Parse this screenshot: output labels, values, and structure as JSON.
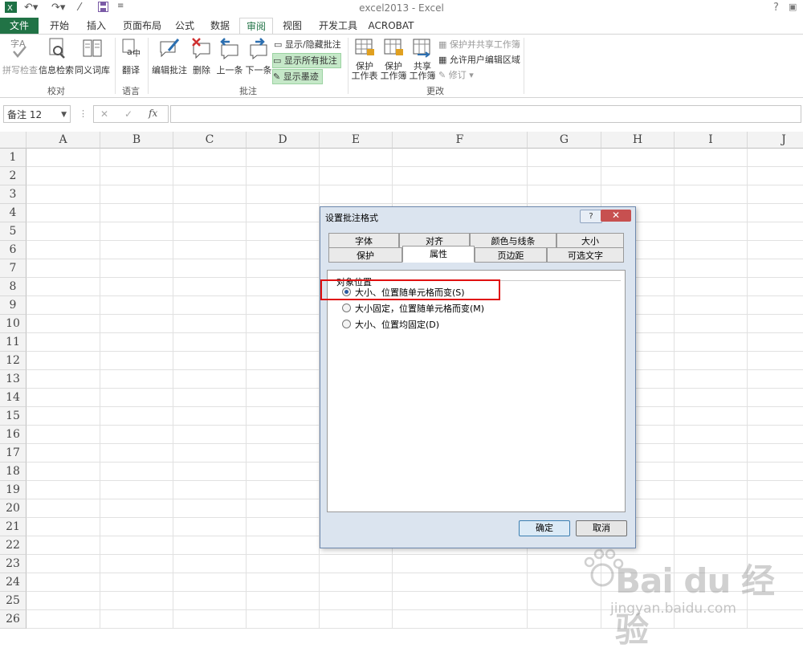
{
  "window": {
    "title": "excel2013 - Excel",
    "help": "?"
  },
  "tabs": [
    {
      "label": "文件"
    },
    {
      "label": "开始"
    },
    {
      "label": "插入"
    },
    {
      "label": "页面布局"
    },
    {
      "label": "公式"
    },
    {
      "label": "数据"
    },
    {
      "label": "审阅"
    },
    {
      "label": "视图"
    },
    {
      "label": "开发工具"
    },
    {
      "label": "ACROBAT"
    }
  ],
  "ribbon": {
    "proofing": {
      "spell": "拼写检查",
      "research": "信息检索",
      "thesaurus": "同义词库",
      "label": "校对"
    },
    "language": {
      "translate": "翻译",
      "label": "语言"
    },
    "comments": {
      "edit": "编辑批注",
      "delete": "删除",
      "prev": "上一条",
      "next": "下一条",
      "show_hide": "显示/隐藏批注",
      "show_all": "显示所有批注",
      "show_ink": "显示墨迹",
      "label": "批注"
    },
    "changes": {
      "protect_sheet_1": "保护",
      "protect_sheet_2": "工作表",
      "protect_wb_1": "保护",
      "protect_wb_2": "工作簿",
      "share_1": "共享",
      "share_2": "工作簿",
      "protect_share": "保护并共享工作簿",
      "allow_edit": "允许用户编辑区域",
      "track": "修订",
      "label": "更改"
    },
    "accent": "#217346"
  },
  "formula_bar": {
    "name_box": "备注 12",
    "fx": "fx",
    "cancel": "✕",
    "enter": "✓",
    "value": ""
  },
  "grid": {
    "columns": [
      "A",
      "B",
      "C",
      "D",
      "E",
      "F",
      "G",
      "H",
      "I",
      "J"
    ],
    "rows": [
      "1",
      "2",
      "3",
      "4",
      "5",
      "6",
      "7",
      "8",
      "9",
      "10",
      "11",
      "12",
      "13",
      "14",
      "15",
      "16",
      "17",
      "18",
      "19",
      "20",
      "21",
      "22",
      "23",
      "24",
      "25",
      "26"
    ]
  },
  "dialog": {
    "title": "设置批注格式",
    "help": "?",
    "close": "✕",
    "tabs_row1": [
      "字体",
      "对齐",
      "颜色与线条",
      "大小"
    ],
    "tabs_row2": [
      "保护",
      "属性",
      "页边距",
      "可选文字"
    ],
    "active_tab": "属性",
    "section": "对象位置",
    "options": [
      {
        "label": "大小、位置随单元格而变(S)",
        "selected": true
      },
      {
        "label": "大小固定，位置随单元格而变(M)",
        "selected": false
      },
      {
        "label": "大小、位置均固定(D)",
        "selected": false
      }
    ],
    "ok": "确定",
    "cancel": "取消"
  },
  "watermark": {
    "brand": "Bai du 经验",
    "url": "jingyan.baidu.com"
  }
}
